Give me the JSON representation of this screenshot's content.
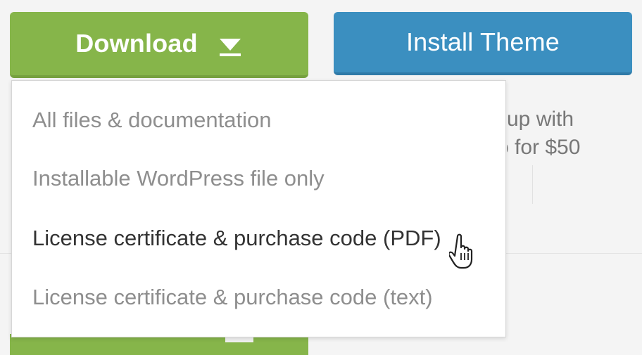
{
  "buttons": {
    "download_label": "Download",
    "install_label": "Install Theme"
  },
  "background_text": {
    "line1": "up with",
    "line2": "o for $50"
  },
  "menu": {
    "items": [
      {
        "label": "All files & documentation",
        "active": false
      },
      {
        "label": "Installable WordPress file only",
        "active": false
      },
      {
        "label": "License certificate & purchase code (PDF)",
        "active": true
      },
      {
        "label": "License certificate & purchase code (text)",
        "active": false
      }
    ]
  },
  "colors": {
    "download_green": "#86b54a",
    "install_blue": "#3b8fc0",
    "menu_text": "#8e8e8e",
    "menu_text_hover": "#333333"
  },
  "icons": {
    "caret": "caret-down-icon",
    "cursor": "hand-pointer-icon"
  }
}
